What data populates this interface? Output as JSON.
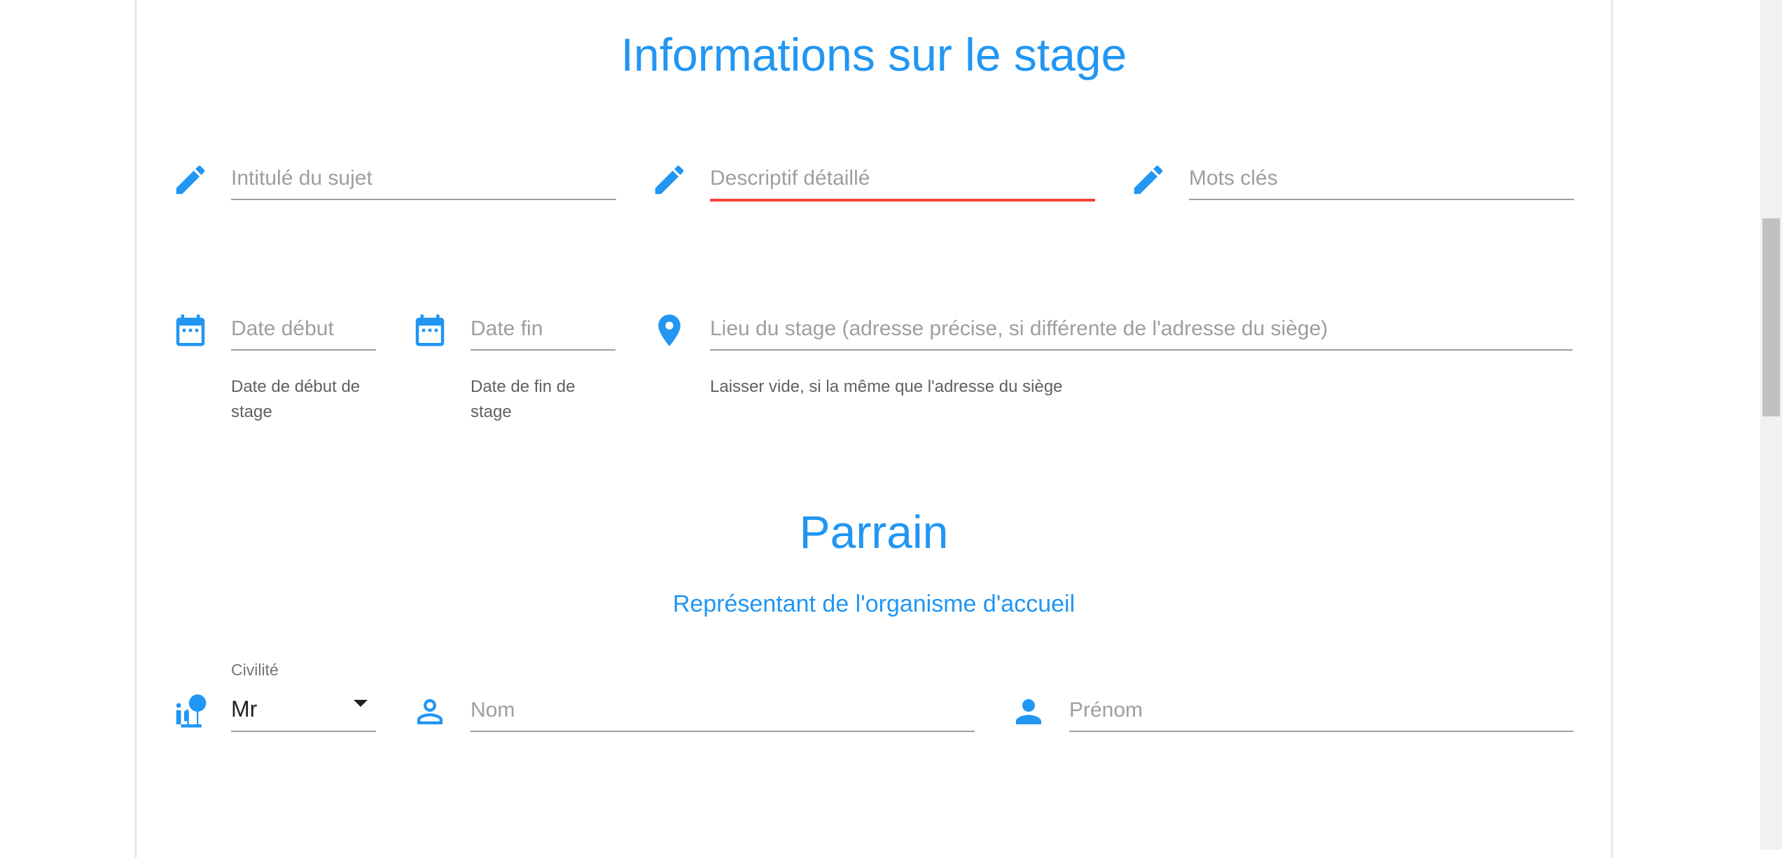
{
  "stage": {
    "title": "Informations sur le stage",
    "subject_title": {
      "placeholder": "Intitulé du sujet",
      "icon": "pencil-icon"
    },
    "description": {
      "placeholder": "Descriptif détaillé",
      "icon": "pencil-icon"
    },
    "keywords": {
      "placeholder": "Mots clés",
      "icon": "pencil-icon"
    },
    "start_date": {
      "placeholder": "Date début",
      "helper": "Date de début de stage",
      "icon": "calendar-icon"
    },
    "end_date": {
      "placeholder": "Date fin",
      "helper": "Date de fin de stage",
      "icon": "calendar-icon"
    },
    "location": {
      "placeholder": "Lieu du stage (adresse précise, si différente de l'adresse du siège)",
      "helper": "Laisser vide, si la même que l'adresse du siège",
      "icon": "map-marker-icon"
    }
  },
  "parrain": {
    "title": "Parrain",
    "subtitle": "Représentant de l'organisme d'accueil",
    "civility": {
      "label": "Civilité",
      "value": "Mr",
      "icon": "person-tree-icon"
    },
    "last_name": {
      "placeholder": "Nom",
      "icon": "person-outline-icon"
    },
    "first_name": {
      "placeholder": "Prénom",
      "icon": "person-icon"
    }
  },
  "colors": {
    "accent": "#2196f3",
    "error_underline": "#f44336",
    "underline": "#9e9e9e"
  }
}
